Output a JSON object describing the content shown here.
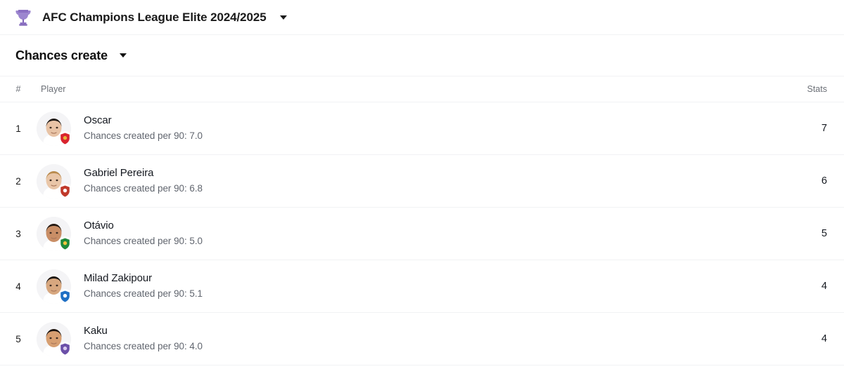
{
  "header": {
    "trophy_icon": "trophy-icon",
    "competition": "AFC Champions League Elite 2024/2025",
    "dropdown_icon": "chevron-down-icon",
    "trophy_color": "#8b6fc4"
  },
  "stat_selector": {
    "label": "Chances create",
    "dropdown_icon": "chevron-down-icon"
  },
  "table": {
    "columns": {
      "rank": "#",
      "player": "Player",
      "stat": "Stats"
    },
    "rows": [
      {
        "rank": "1",
        "name": "Oscar",
        "subtitle": "Chances created per 90: 7.0",
        "stat": "7",
        "badge_color": "#d9232e",
        "badge_accent": "#e8b33a",
        "skin": "#e8c3a6",
        "hair": "#1f1a17",
        "shirt": "#ffffff"
      },
      {
        "rank": "2",
        "name": "Gabriel Pereira",
        "subtitle": "Chances created per 90: 6.8",
        "stat": "6",
        "badge_color": "#c0392b",
        "badge_accent": "#ffffff",
        "skin": "#e9c6a8",
        "hair": "#b98b4e",
        "shirt": "#ffffff"
      },
      {
        "rank": "3",
        "name": "Otávio",
        "subtitle": "Chances created per 90: 5.0",
        "stat": "5",
        "badge_color": "#1f8a3b",
        "badge_accent": "#f2c53d",
        "skin": "#c98e66",
        "hair": "#241a14",
        "shirt": "#ffffff"
      },
      {
        "rank": "4",
        "name": "Milad Zakipour",
        "subtitle": "Chances created per 90: 5.1",
        "stat": "4",
        "badge_color": "#1f6fc4",
        "badge_accent": "#ffffff",
        "skin": "#d7a77f",
        "hair": "#17120f",
        "shirt": "#ffffff"
      },
      {
        "rank": "5",
        "name": "Kaku",
        "subtitle": "Chances created per 90: 4.0",
        "stat": "4",
        "badge_color": "#6b4fa8",
        "badge_accent": "#d8c8ef",
        "skin": "#d79f72",
        "hair": "#1a1411",
        "shirt": "#ffffff"
      }
    ]
  }
}
